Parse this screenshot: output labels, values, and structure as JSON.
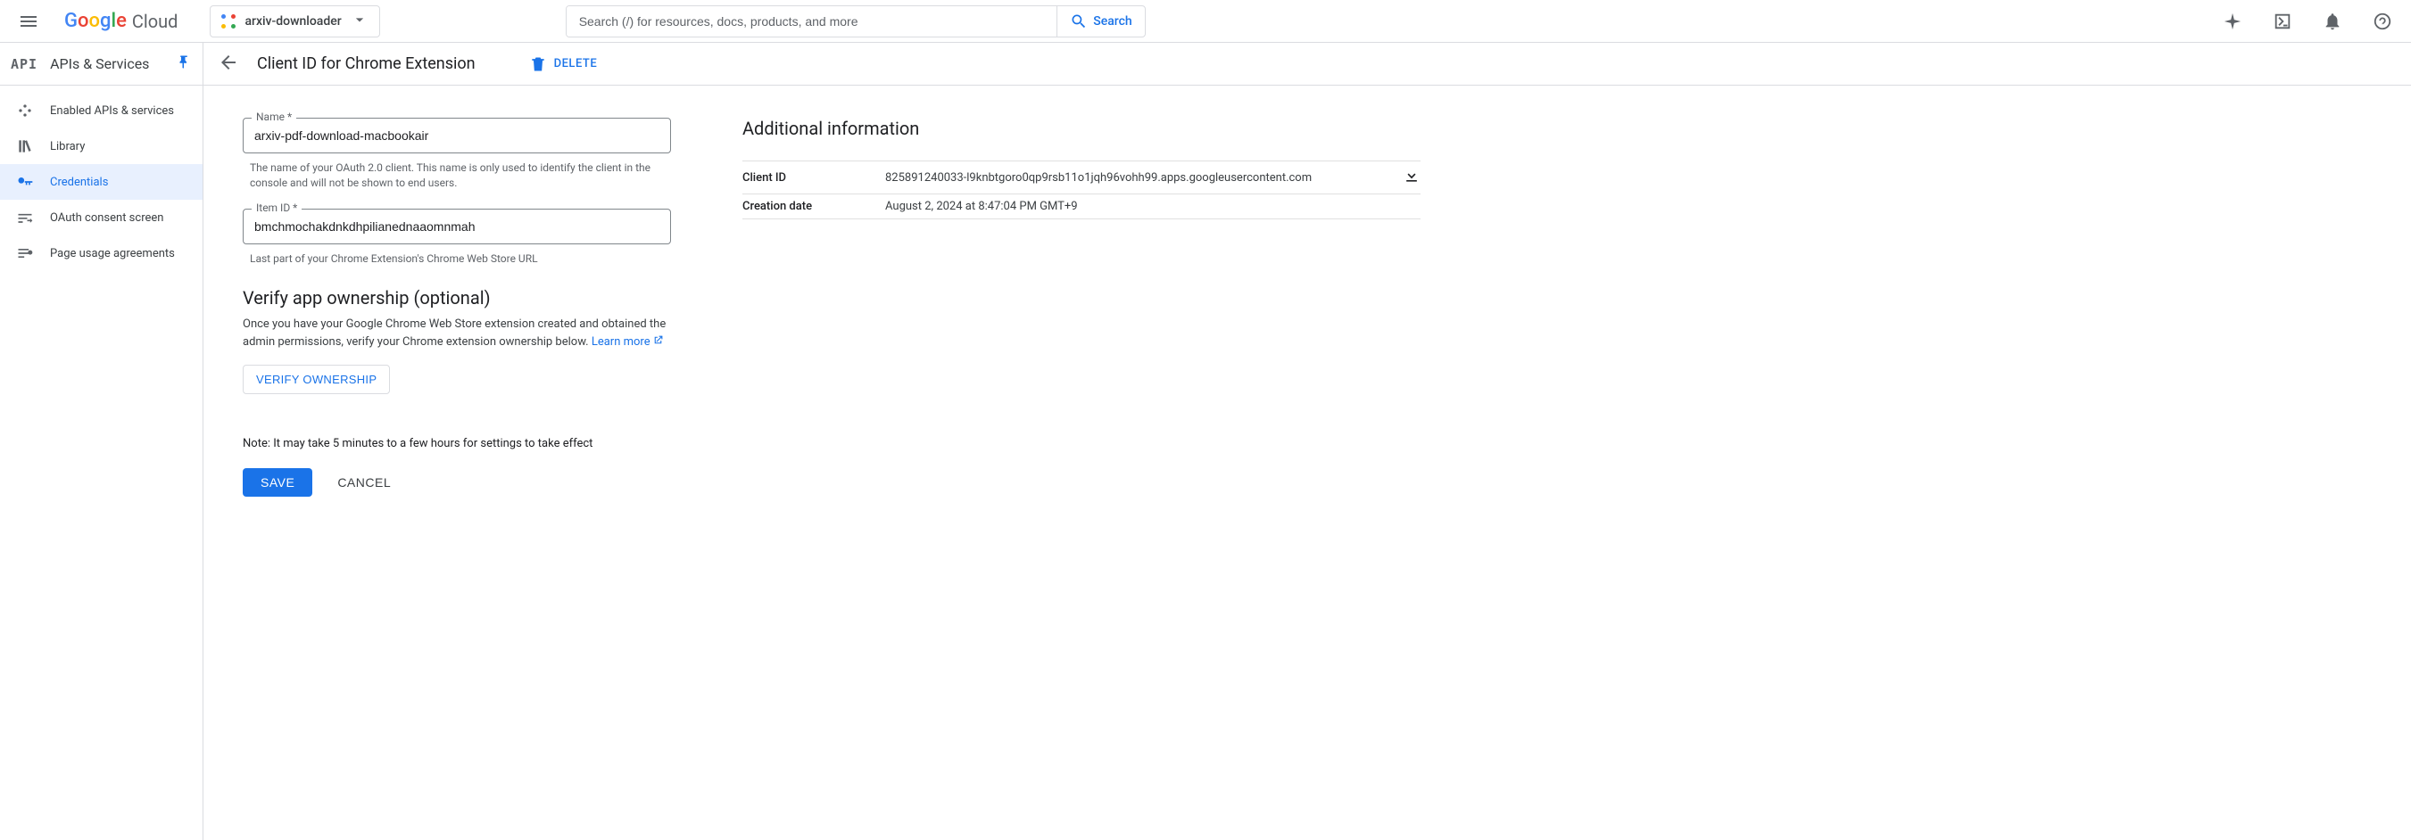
{
  "header": {
    "cloud_word": "Cloud",
    "project_name": "arxiv-downloader",
    "search_placeholder": "Search (/) for resources, docs, products, and more",
    "search_button": "Search"
  },
  "product": {
    "badge": "API",
    "title": "APIs & Services"
  },
  "sidenav": {
    "items": [
      {
        "label": "Enabled APIs & services"
      },
      {
        "label": "Library"
      },
      {
        "label": "Credentials"
      },
      {
        "label": "OAuth consent screen"
      },
      {
        "label": "Page usage agreements"
      }
    ]
  },
  "page": {
    "title": "Client ID for Chrome Extension",
    "delete_label": "DELETE"
  },
  "form": {
    "name_label": "Name *",
    "name_value": "arxiv-pdf-download-macbookair",
    "name_helper": "The name of your OAuth 2.0 client. This name is only used to identify the client in the console and will not be shown to end users.",
    "itemid_label": "Item ID *",
    "itemid_value": "bmchmochakdnkdhpilianednaaomnmah",
    "itemid_helper": "Last part of your Chrome Extension's Chrome Web Store URL",
    "verify_heading": "Verify app ownership (optional)",
    "verify_desc": "Once you have your Google Chrome Web Store extension created and obtained the admin permissions, verify your Chrome extension ownership below. ",
    "learn_more": "Learn more",
    "verify_button": "VERIFY OWNERSHIP",
    "note": "Note: It may take 5 minutes to a few hours for settings to take effect",
    "save": "SAVE",
    "cancel": "CANCEL"
  },
  "info": {
    "heading": "Additional information",
    "client_id_label": "Client ID",
    "client_id_value": "825891240033-l9knbtgoro0qp9rsb11o1jqh96vohh99.apps.googleusercontent.com",
    "creation_label": "Creation date",
    "creation_value": "August 2, 2024 at 8:47:04 PM GMT+9"
  }
}
